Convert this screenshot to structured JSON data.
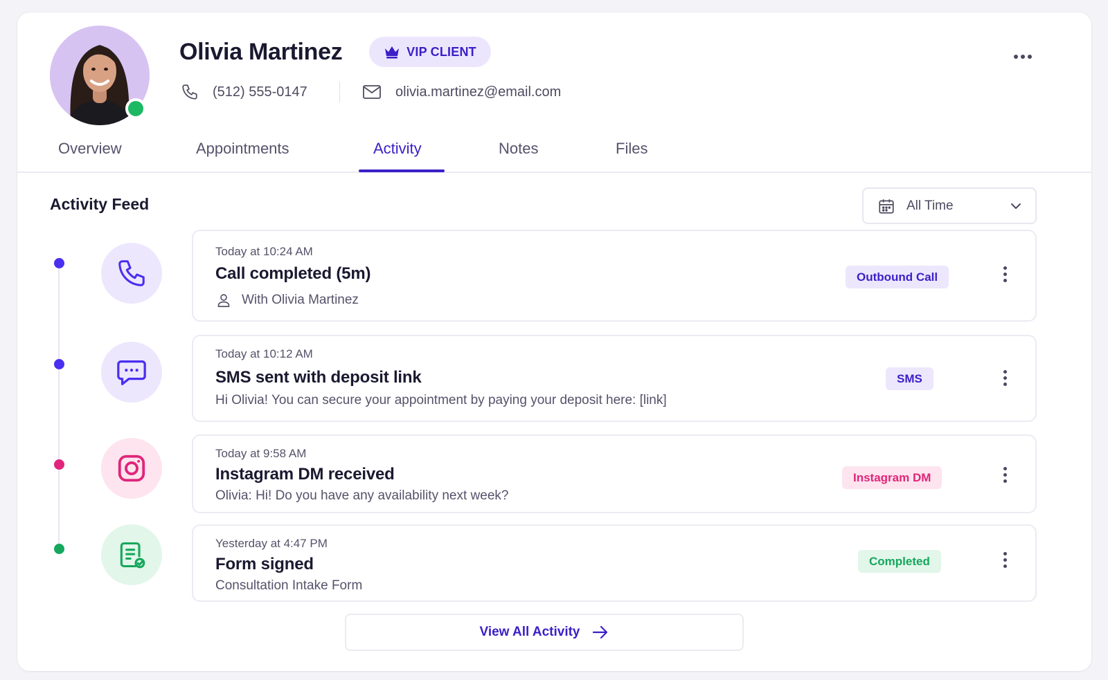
{
  "profile": {
    "name": "Olivia Martinez",
    "vip_label": "VIP CLIENT",
    "phone": "(512) 555-0147",
    "email": "olivia.martinez@email.com",
    "online": true
  },
  "tabs": [
    {
      "label": "Overview",
      "active": false
    },
    {
      "label": "Appointments",
      "active": false
    },
    {
      "label": "Activity",
      "active": true
    },
    {
      "label": "Notes",
      "active": false
    },
    {
      "label": "Files",
      "active": false
    }
  ],
  "feed": {
    "title": "Activity Feed",
    "filter_label": "All Time",
    "view_all_label": "View All Activity",
    "items": [
      {
        "time": "Today at 10:24 AM",
        "title": "Call completed (5m)",
        "subtitle": "With Olivia Martinez",
        "badge": "Outbound Call",
        "icon": "phone-icon",
        "color": "#4a2ff0"
      },
      {
        "time": "Today at 10:12 AM",
        "title": "SMS sent with deposit link",
        "subtitle": "Hi Olivia! You can secure your appointment by paying your deposit here: [link]",
        "badge": "SMS",
        "icon": "chat-icon",
        "color": "#4a2ff0"
      },
      {
        "time": "Today at 9:58 AM",
        "title": "Instagram DM received",
        "subtitle": "Olivia: Hi! Do you have any availability next week?",
        "badge": "Instagram DM",
        "icon": "instagram-icon",
        "color": "#e0257a"
      },
      {
        "time": "Yesterday at 4:47 PM",
        "title": "Form signed",
        "subtitle": "Consultation Intake Form",
        "badge": "Completed",
        "icon": "form-signed-icon",
        "color": "#16a75c"
      }
    ]
  },
  "colors": {
    "accent": "#3b1fc7",
    "purple_soft": "#ede7fd",
    "pink": "#e0257a",
    "pink_soft": "#fde4ee",
    "green": "#16a75c",
    "green_soft": "#e2f6ea",
    "online": "#1db863"
  }
}
